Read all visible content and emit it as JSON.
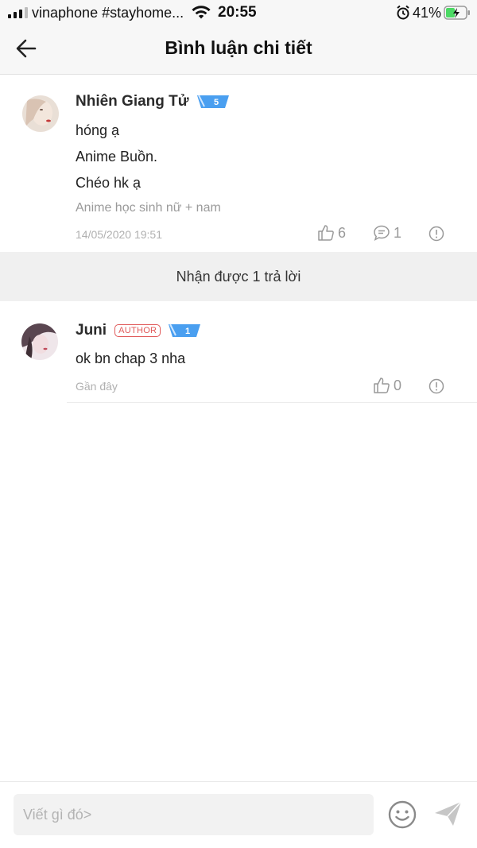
{
  "status_bar": {
    "carrier": "vinaphone #stayhome...",
    "time": "20:55",
    "battery": "41%"
  },
  "header": {
    "title": "Bình luận chi tiết",
    "back_icon": "arrow-left-icon"
  },
  "main_comment": {
    "user_name": "Nhiên Giang Tử",
    "vip_level": "5",
    "lines": [
      "hóng ạ",
      "Anime Buồn.",
      "Chéo hk ạ"
    ],
    "subtext": "Anime học sinh nữ + nam",
    "date": "14/05/2020 19:51",
    "likes": "6",
    "replies": "1"
  },
  "replies_bar": {
    "label": "Nhận được 1 trả lời"
  },
  "reply": {
    "user_name": "Juni",
    "role_badge": "AUTHOR",
    "vip_level": "1",
    "text": "ok bn chap 3 nha",
    "time": "Gần đây",
    "likes": "0"
  },
  "bottom_bar": {
    "placeholder": "Viết gì đó>"
  },
  "colors": {
    "vip_blue": "#4a9ff0",
    "author_red": "#e05a5a",
    "muted_gray": "#9a9a9a"
  }
}
